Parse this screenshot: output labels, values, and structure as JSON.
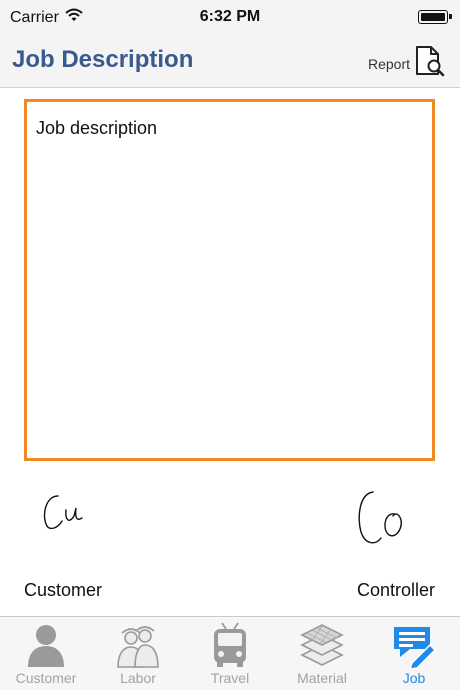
{
  "status_bar": {
    "carrier": "Carrier",
    "time": "6:32 PM"
  },
  "nav": {
    "title": "Job Description",
    "report_label": "Report"
  },
  "job": {
    "description_placeholder": "Job description",
    "customer_label": "Customer",
    "controller_label": "Controller"
  },
  "tabs": [
    {
      "label": "Customer",
      "icon": "person-icon",
      "active": false
    },
    {
      "label": "Labor",
      "icon": "workers-icon",
      "active": false
    },
    {
      "label": "Travel",
      "icon": "bus-icon",
      "active": false
    },
    {
      "label": "Material",
      "icon": "layers-icon",
      "active": false
    },
    {
      "label": "Job",
      "icon": "job-edit-icon",
      "active": true
    }
  ],
  "colors": {
    "accent": "#1f8be8",
    "title": "#3a5a8e",
    "box_border": "#f0891f",
    "tab_inactive": "#a2a2a2"
  }
}
